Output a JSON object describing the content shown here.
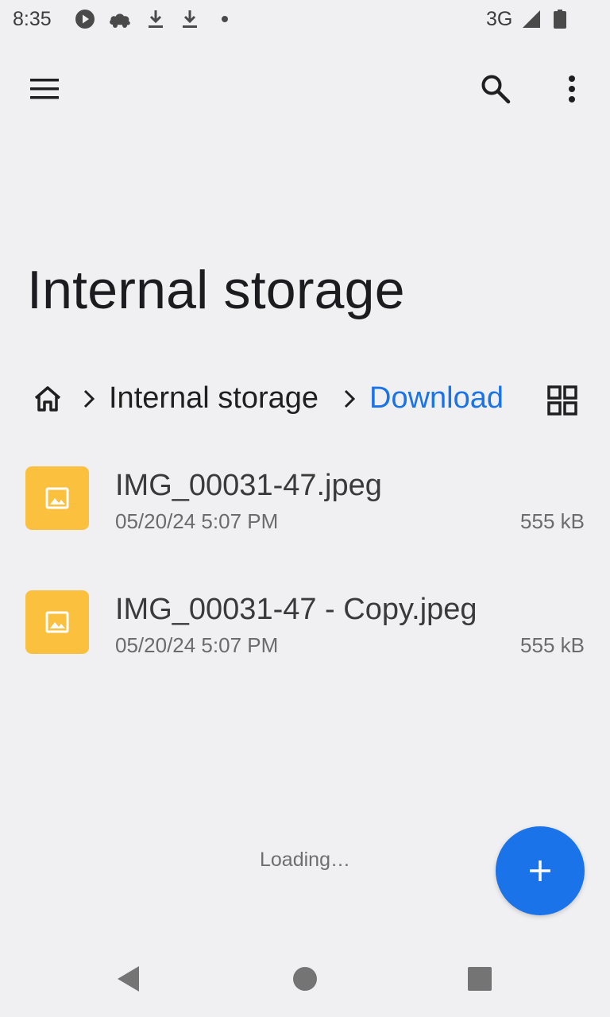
{
  "status_bar": {
    "time": "8:35",
    "network": "3G",
    "icons": [
      "play-icon",
      "cloud-icon",
      "download-icon",
      "download-icon",
      "dot-icon",
      "signal-icon",
      "battery-icon"
    ]
  },
  "app_bar": {
    "icons": [
      "menu-icon",
      "search-icon",
      "more-vert-icon"
    ]
  },
  "page_title": "Internal storage",
  "breadcrumb": {
    "items": [
      "Internal storage",
      "Download"
    ],
    "current_color": "#1a73e8"
  },
  "files": [
    {
      "name": "IMG_00031-47.jpeg",
      "date": "05/20/24 5:07 PM",
      "size": "555 kB",
      "icon": "image-icon"
    },
    {
      "name": "IMG_00031-47 - Copy.jpeg",
      "date": "05/20/24 5:07 PM",
      "size": "555 kB",
      "icon": "image-icon"
    }
  ],
  "loading_text": "Loading…",
  "colors": {
    "accent": "#1a73e8",
    "thumb": "#fbc13e",
    "background": "#f0f0f3"
  }
}
